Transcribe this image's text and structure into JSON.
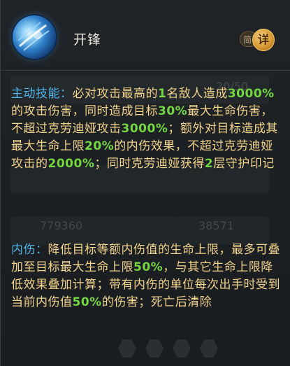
{
  "skill": {
    "name": "开锋",
    "toggle_simple": "简",
    "toggle_detail": "详"
  },
  "background": {
    "level": "20/50",
    "stat_left": "779360",
    "stat_right": "38571"
  },
  "sections": [
    {
      "label": "主动技能：",
      "parts": [
        {
          "t": "必对攻击最高的",
          "n": false
        },
        {
          "t": "1",
          "n": true
        },
        {
          "t": "名敌人造成",
          "n": false
        },
        {
          "t": "3000%",
          "n": true
        },
        {
          "t": "的攻击伤害，同时造成目标",
          "n": false
        },
        {
          "t": "30%",
          "n": true
        },
        {
          "t": "最大生命伤害，不超过克劳迪娅攻击",
          "n": false
        },
        {
          "t": "3000%",
          "n": true
        },
        {
          "t": "；额外对目标造成其最大生命上限",
          "n": false
        },
        {
          "t": "20%",
          "n": true
        },
        {
          "t": "的内伤效果，不超过克劳迪娅攻击的",
          "n": false
        },
        {
          "t": "2000%",
          "n": true
        },
        {
          "t": "；同时克劳迪娅获得",
          "n": false
        },
        {
          "t": "2",
          "n": true
        },
        {
          "t": "层守护印记",
          "n": false
        }
      ]
    },
    {
      "label": "内伤：",
      "parts": [
        {
          "t": "降低目标等额内伤值的生命上限，最多可叠加至目标最大生命上限",
          "n": false
        },
        {
          "t": "50%",
          "n": true
        },
        {
          "t": "，与其它生命上限降低效果叠加计算；带有内伤的单位每次出手时受到当前内伤值",
          "n": false
        },
        {
          "t": "50%",
          "n": true
        },
        {
          "t": "的伤害；死亡后清除",
          "n": false
        }
      ]
    }
  ],
  "colors": {
    "label": "#4fb7ec",
    "text": "#f2d38b",
    "number": "#74d641"
  }
}
